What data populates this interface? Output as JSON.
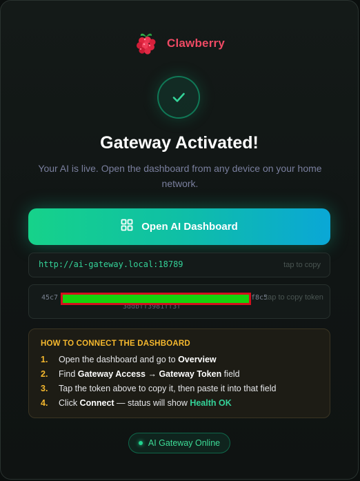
{
  "brand": {
    "name": "Clawberry",
    "logo_icon": "raspberry-icon"
  },
  "status_icon": "checkmark-icon",
  "title": "Gateway Activated!",
  "subtitle": "Your AI is live. Open the dashboard from any device on your home network.",
  "open_button": {
    "label": "Open AI Dashboard",
    "icon": "grid-icon"
  },
  "url_field": {
    "value": "http://ai-gateway.local:18789",
    "hint": "tap to copy"
  },
  "token_field": {
    "visible_start": "45c7",
    "visible_end": "f8c5",
    "visible_line2": "3ddbff3981ff3f",
    "hint": "tap to copy token",
    "redacted": true
  },
  "howto": {
    "title": "HOW TO CONNECT THE DASHBOARD",
    "steps": [
      {
        "num": "1.",
        "pre": "Open the dashboard and go to ",
        "bold": "Overview",
        "post": ""
      },
      {
        "num": "2.",
        "pre": "Find ",
        "bold": "Gateway Access → Gateway Token",
        "post": " field"
      },
      {
        "num": "3.",
        "pre": "Tap the token above to copy it, then paste it into that field",
        "bold": "",
        "post": ""
      },
      {
        "num": "4.",
        "pre": "Click ",
        "bold": "Connect",
        "post": " — status will show ",
        "highlight": "Health OK"
      }
    ]
  },
  "status_pill": {
    "label": "AI Gateway Online"
  },
  "colors": {
    "accent_green": "#34d399",
    "brand_red": "#ef4a64",
    "warning_yellow": "#f5b82e",
    "button_gradient_start": "#16d28a",
    "button_gradient_end": "#0aa7d6"
  }
}
